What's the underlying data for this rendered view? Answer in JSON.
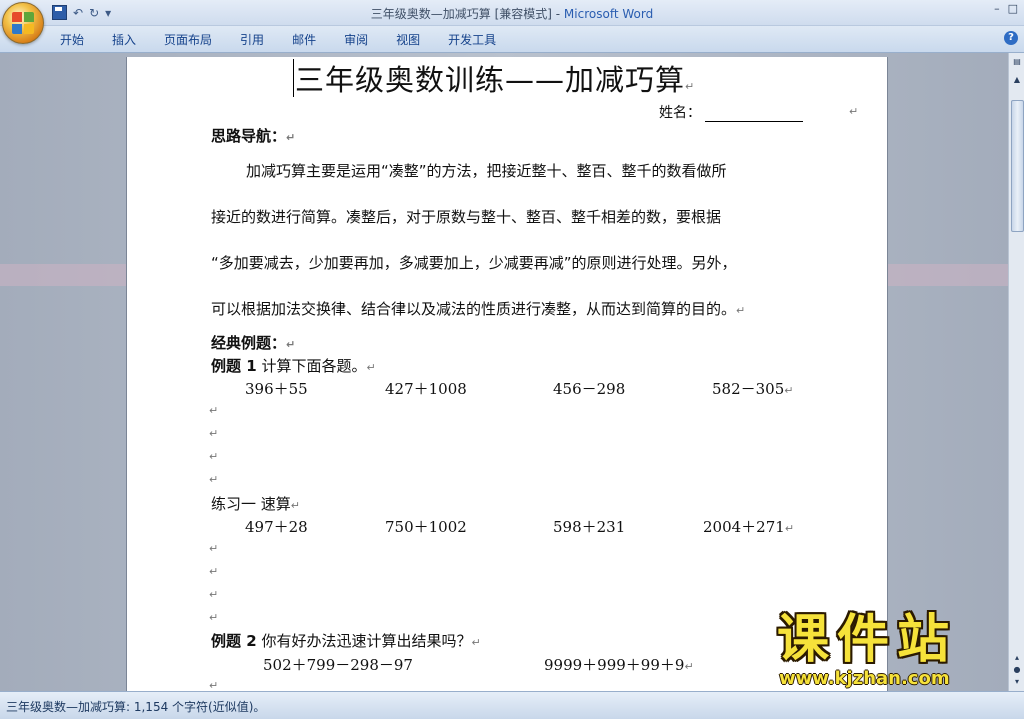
{
  "window": {
    "title_doc": "三年级奥数—加减巧算 [兼容模式] - ",
    "title_app": "Microsoft Word",
    "controls": [
      "–",
      "□"
    ]
  },
  "qat": {
    "undo": "↶",
    "redo": "↻",
    "more": "▾"
  },
  "ribbon": {
    "tabs": [
      "开始",
      "插入",
      "页面布局",
      "引用",
      "邮件",
      "审阅",
      "视图",
      "开发工具"
    ],
    "help": "?"
  },
  "document": {
    "title": "三年级奥数训练——加减巧算",
    "name_label": "姓名：",
    "pilcrow": "↵",
    "section1": "思路导航：",
    "para": [
      "加减巧算主要是运用“凑整”的方法，把接近整十、整百、整千的数看做所",
      "接近的数进行简算。凑整后，对于原数与整十、整百、整千相差的数，要根据",
      "“多加要减去，少加要再加，多减要加上，少减要再减”的原则进行处理。另外，",
      "可以根据加法交换律、结合律以及减法的性质进行凑整，从而达到简算的目的。"
    ],
    "section2": "经典例题：",
    "ex1_label": "例题 1",
    "ex1_text": " 计算下面各题。",
    "ex1_problems": [
      "396＋55",
      "427＋1008",
      "456－298",
      "582－305"
    ],
    "practice_label": "练习一      速算",
    "practice_problems": [
      "497＋28",
      "750＋1002",
      "598＋231",
      "2004＋271"
    ],
    "ex2_label": "例题 2",
    "ex2_text": " 你有好办法迅速计算出结果吗？",
    "ex2_problems": [
      "502＋799－298－97",
      "9999＋999＋99＋9"
    ]
  },
  "statusbar": {
    "text": "三年级奥数—加减巧算: 1,154 个字符(近似值)。"
  },
  "watermark": {
    "chinese": "课件站",
    "url": "www.kjzhan.com"
  }
}
